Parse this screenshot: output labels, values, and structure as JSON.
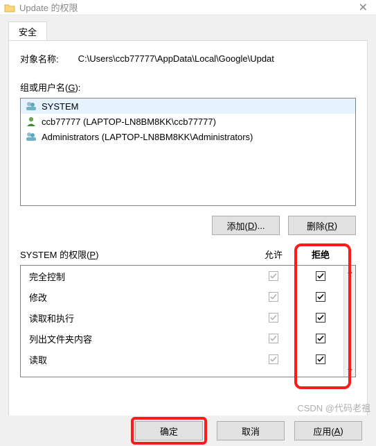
{
  "window": {
    "title": "Update 的权限",
    "close_glyph": "✕"
  },
  "tabs": {
    "security": "安全"
  },
  "object": {
    "label": "对象名称:",
    "path": "C:\\Users\\ccb77777\\AppData\\Local\\Google\\Updat"
  },
  "groups": {
    "label_prefix": "组或用户名(",
    "label_u": "G",
    "label_suffix": "):",
    "items": [
      {
        "name": "SYSTEM",
        "icon": "group"
      },
      {
        "name": "ccb77777 (LAPTOP-LN8BM8KK\\ccb77777)",
        "icon": "user"
      },
      {
        "name": "Administrators (LAPTOP-LN8BM8KK\\Administrators)",
        "icon": "group"
      }
    ]
  },
  "buttons": {
    "add_prefix": "添加(",
    "add_u": "D",
    "add_suffix": ")...",
    "remove_prefix": "删除(",
    "remove_u": "R",
    "remove_suffix": ")",
    "ok": "确定",
    "cancel": "取消",
    "apply_prefix": "应用(",
    "apply_u": "A",
    "apply_suffix": ")"
  },
  "permissions": {
    "title_prefix": "SYSTEM 的权限(",
    "title_u": "P",
    "title_suffix": ")",
    "col_allow": "允许",
    "col_deny": "拒绝",
    "rows": [
      {
        "name": "完全控制"
      },
      {
        "name": "修改"
      },
      {
        "name": "读取和执行"
      },
      {
        "name": "列出文件夹内容"
      },
      {
        "name": "读取"
      }
    ]
  },
  "watermark": "CSDN @代码老祖"
}
